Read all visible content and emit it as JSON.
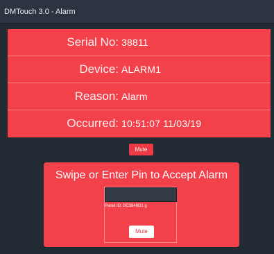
{
  "window": {
    "title": "DMTouch 3.0 - Alarm"
  },
  "details": [
    {
      "label": "Serial No:",
      "value": "38811"
    },
    {
      "label": "Device:",
      "value": "ALARM1"
    },
    {
      "label": "Reason:",
      "value": "Alarm"
    },
    {
      "label": "Occurred:",
      "value": "10:51:07 11/03/19"
    }
  ],
  "top_mute": {
    "label": "Mute"
  },
  "accept": {
    "title": "Swipe or Enter Pin to Accept Alarm",
    "pin_value": "",
    "panel_id": "Panel ID: BC3648D1 g",
    "mute_label": "Mute"
  },
  "colors": {
    "background": "#222a33",
    "titlebar": "#2b3440",
    "alarm_red": "#f2414a",
    "row_divider": "#ff7c82",
    "pin_field": "#323b43"
  }
}
